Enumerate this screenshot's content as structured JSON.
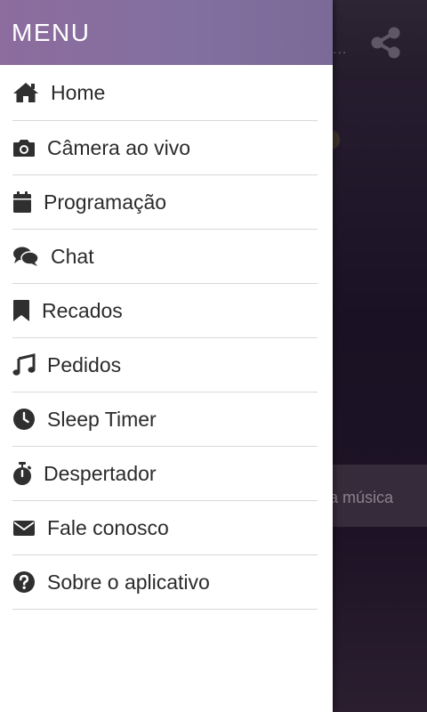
{
  "background": {
    "dots": "...",
    "bar_text": "a música"
  },
  "drawer": {
    "title": "MENU",
    "items": [
      {
        "label": "Home",
        "icon": "home-icon"
      },
      {
        "label": "Câmera ao vivo",
        "icon": "camera-icon"
      },
      {
        "label": "Programação",
        "icon": "calendar-icon"
      },
      {
        "label": "Chat",
        "icon": "chat-icon"
      },
      {
        "label": "Recados",
        "icon": "bookmark-icon"
      },
      {
        "label": "Pedidos",
        "icon": "music-note-icon"
      },
      {
        "label": "Sleep Timer",
        "icon": "clock-icon"
      },
      {
        "label": "Despertador",
        "icon": "stopwatch-icon"
      },
      {
        "label": "Fale conosco",
        "icon": "envelope-icon"
      },
      {
        "label": "Sobre o aplicativo",
        "icon": "question-circle-icon"
      }
    ]
  },
  "colors": {
    "header_gradient_start": "#8d6c9e",
    "header_gradient_end": "#7b6a98",
    "icon_color": "#2f2f2f",
    "divider": "#d8d8d8"
  }
}
